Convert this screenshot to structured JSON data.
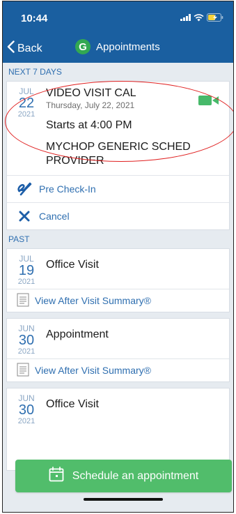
{
  "status_bar": {
    "time": "10:44"
  },
  "nav": {
    "back_label": "Back",
    "logo_letter": "G",
    "title": "Appointments"
  },
  "upcoming": {
    "header": "NEXT 7 DAYS",
    "appointment": {
      "month": "JUL",
      "day": "22",
      "year": "2021",
      "title": "VIDEO VISIT CAL",
      "date_text": "Thursday, July 22, 2021",
      "start_text": "Starts at 4:00 PM",
      "provider": "MYCHOP GENERIC SCHED PROVIDER"
    },
    "actions": {
      "precheckin_label": "Pre Check-In",
      "cancel_label": "Cancel"
    }
  },
  "past": {
    "header": "PAST",
    "items": [
      {
        "month": "JUL",
        "day": "19",
        "year": "2021",
        "title": "Office Visit",
        "summary_label": "View After Visit Summary®"
      },
      {
        "month": "JUN",
        "day": "30",
        "year": "2021",
        "title": "Appointment",
        "summary_label": "View After Visit Summary®"
      },
      {
        "month": "JUN",
        "day": "30",
        "year": "2021",
        "title": "Office Visit"
      }
    ]
  },
  "schedule_button_label": "Schedule an appointment",
  "colors": {
    "primary": "#1a5fa0",
    "link": "#2f6fb0",
    "green": "#51bd6b",
    "annotation": "#e02020"
  }
}
